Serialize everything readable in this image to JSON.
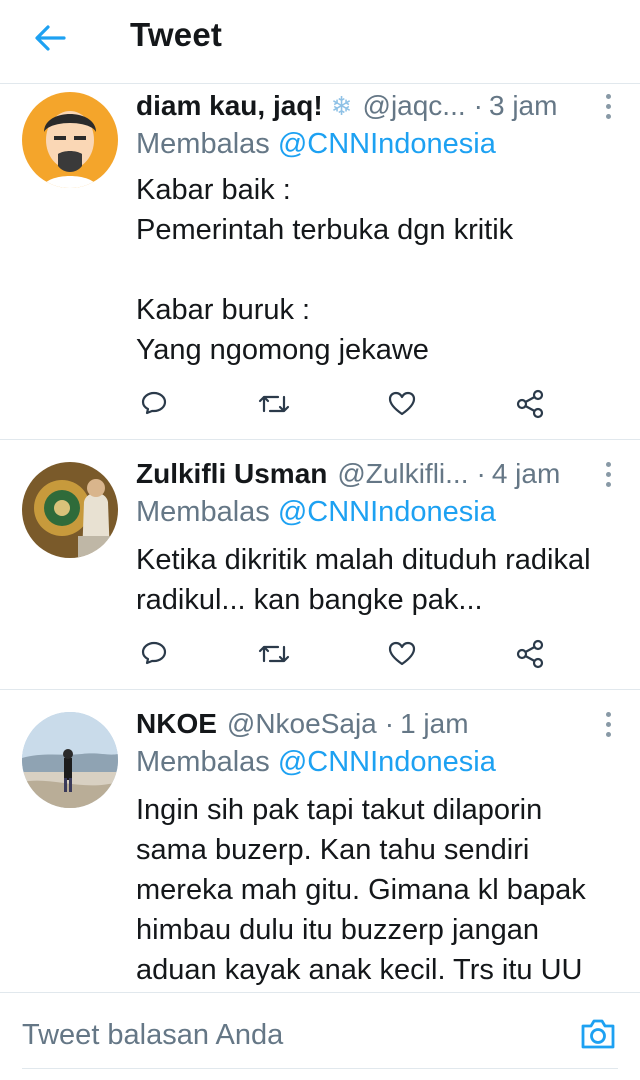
{
  "header": {
    "title": "Tweet",
    "back_icon": "arrow-left-icon"
  },
  "colors": {
    "accent": "#1da1f2",
    "muted": "#657786",
    "text": "#14171a",
    "divider": "#e1e8ed",
    "icon": "#2b3a4a"
  },
  "tweets": [
    {
      "name": "diam kau, jaq!",
      "badge": "❄",
      "handle": "@jaqc...",
      "time": "3 jam",
      "reply_prefix": "Membalas",
      "reply_to": "@CNNIndonesia",
      "text": "Kabar baik :\nPemerintah terbuka dgn kritik\n\nKabar buruk :\nYang ngomong jekawe"
    },
    {
      "name": "Zulkifli Usman",
      "handle": "@Zulkifli...",
      "time": "4 jam",
      "reply_prefix": "Membalas",
      "reply_to": "@CNNIndonesia",
      "text": "Ketika dikritik malah dituduh radikal\nradikul... kan bangke pak..."
    },
    {
      "name": "NKOE",
      "handle": "@NkoeSaja",
      "time": "1 jam",
      "reply_prefix": "Membalas",
      "reply_to": "@CNNIndonesia",
      "text": "Ingin sih pak tapi takut dilaporin\nsama buzerp. Kan tahu sendiri\nmereka mah gitu. Gimana kl bapak\nhimbau dulu itu buzzerp jangan\naduan kayak anak kecil. Trs itu UU"
    }
  ],
  "separator": "·",
  "reply_bar": {
    "placeholder": "Tweet balasan Anda",
    "camera_icon": "camera-icon"
  }
}
